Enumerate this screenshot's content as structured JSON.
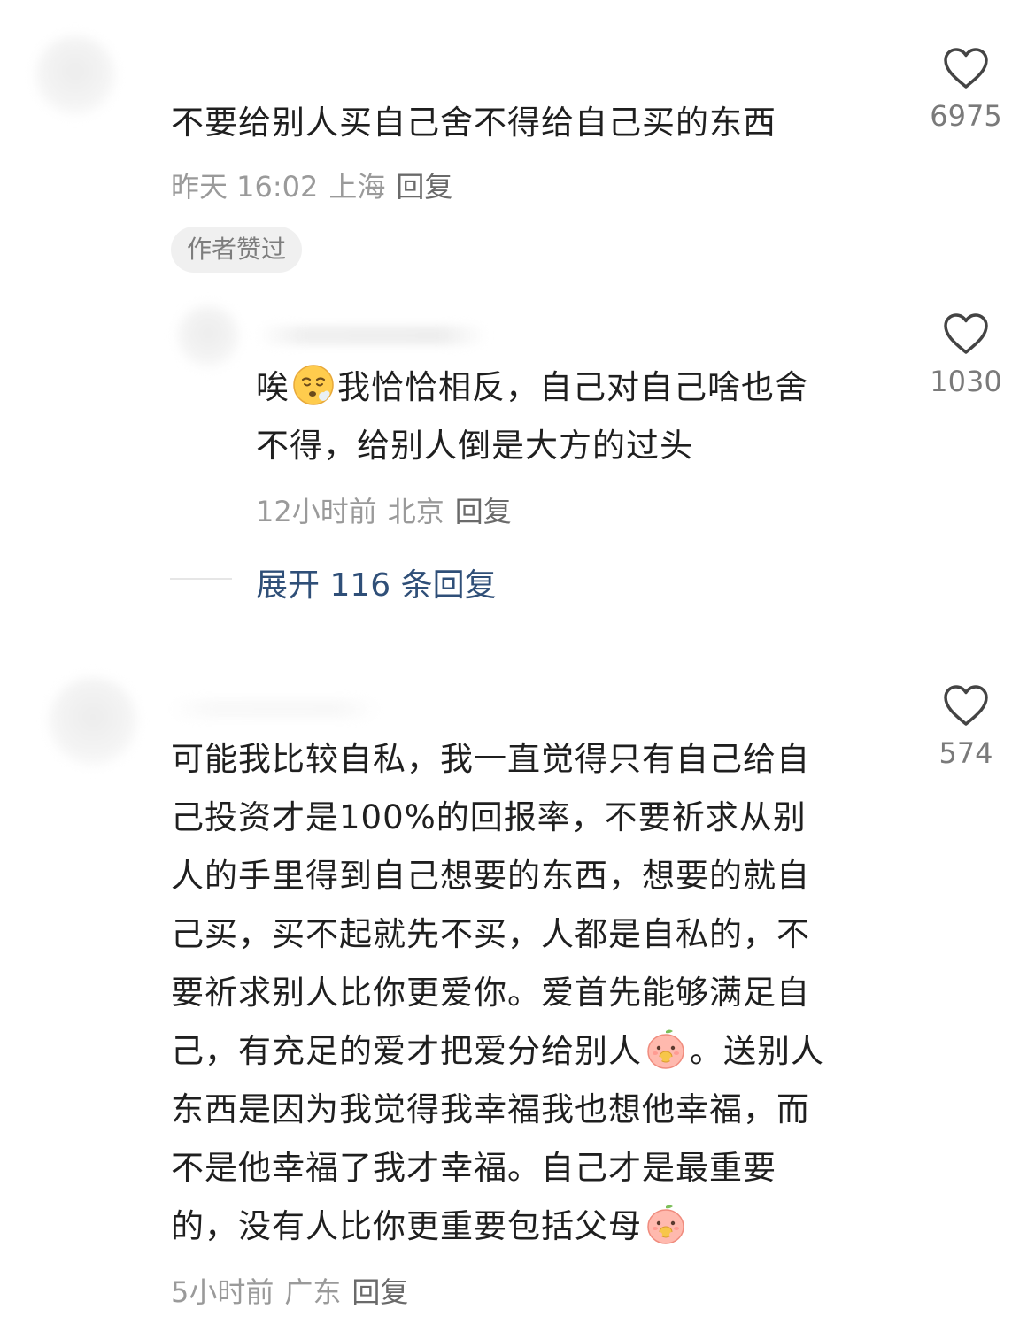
{
  "comments": [
    {
      "text": "不要给别人买自己舍不得给自己买的东西",
      "time": "昨天 16:02",
      "location": "上海",
      "reply_label": "回复",
      "like_count": "6975",
      "badge": "作者赞过"
    },
    {
      "text_part1": "唉",
      "text_part2": "我恰恰相反，自己对自己啥也舍",
      "text_line2": "不得，给别人倒是大方的过头",
      "emoji": "tired-face-emoji",
      "time": "12小时前",
      "location": "北京",
      "reply_label": "回复",
      "like_count": "1030"
    },
    {
      "lines": [
        "可能我比较自私，我一直觉得只有自己给自",
        "己投资才是100%的回报率，不要祈求从别",
        "人的手里得到自己想要的东西，想要的就自",
        "己买，买不起就先不买，人都是自私的，不",
        "要祈求别人比你更爱你。爱首先能够满足自"
      ],
      "line6_part1": "己，有充足的爱才把爱分给别人",
      "line6_part2": "。送别人",
      "lines_b": [
        "东西是因为我觉得我幸福我也想他幸福，而",
        "不是他幸福了我才幸福。自己才是最重要"
      ],
      "line_last": "的，没有人比你更重要包括父母",
      "emoji": "peach-eating-emoji",
      "time": "5小时前",
      "location": "广东",
      "reply_label": "回复",
      "like_count": "574"
    }
  ],
  "expand_replies": "展开 116 条回复",
  "icons": {
    "like": "heart-outline-icon"
  }
}
